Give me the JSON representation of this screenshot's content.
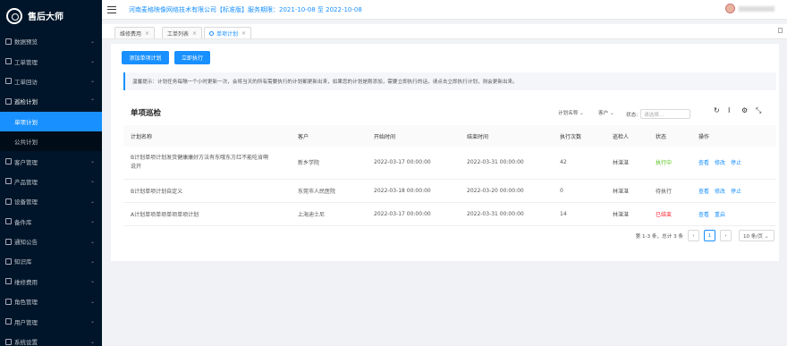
{
  "app": {
    "title": "售后大师"
  },
  "sidebar": {
    "items": [
      {
        "label": "数据预览",
        "arrow": "⌄"
      },
      {
        "label": "工单管理",
        "arrow": "⌄"
      },
      {
        "label": "工单回访",
        "arrow": "⌄"
      },
      {
        "label": "巡检计划",
        "arrow": "⌃"
      },
      {
        "label": "单项计划"
      },
      {
        "label": "公共计划"
      },
      {
        "label": "客户管理",
        "arrow": "⌄"
      },
      {
        "label": "产品管理",
        "arrow": "⌄"
      },
      {
        "label": "设备管理",
        "arrow": "⌄"
      },
      {
        "label": "备件库",
        "arrow": "⌄"
      },
      {
        "label": "通知公告",
        "arrow": "⌄"
      },
      {
        "label": "知识库",
        "arrow": "⌄"
      },
      {
        "label": "维修费用",
        "arrow": "⌄"
      },
      {
        "label": "角色管理",
        "arrow": "⌄"
      },
      {
        "label": "用户管理",
        "arrow": "⌄"
      },
      {
        "label": "系统设置",
        "arrow": "⌄"
      }
    ]
  },
  "header": {
    "company": "河南麦格映像网络技术有限公司【标准版】服务期限：2021-10-08 至 2022-10-08"
  },
  "tabs": [
    {
      "label": "维修费用",
      "close": "×"
    },
    {
      "label": "工单列表",
      "close": "×"
    },
    {
      "label": "单项计划",
      "close": "×"
    }
  ],
  "actions": {
    "add": "添加单项计划",
    "exec": "立即执行"
  },
  "notice": "温馨提示：计划任务每隔一个小时更新一次，会将当天的所有需要执行的计划都更新出来，如果您的计划是刚添加，需要立即执行的话，请点击立即执行计划，则会更新出来。",
  "card": {
    "title": "单项巡检",
    "filters": {
      "plan_name": "计划名称 ⌄",
      "customer": "客户 ⌄",
      "status_label": "状态:",
      "status_placeholder": "请选择..."
    },
    "tools": {
      "refresh": "↻",
      "density": "Ι",
      "settings": "⚙",
      "fullscreen": "⤡"
    }
  },
  "table": {
    "headers": [
      "计划名称",
      "客户",
      "开始时间",
      "结束时间",
      "执行次数",
      "巡检人",
      "状态",
      "操作"
    ],
    "rows": [
      {
        "name": "B计划单项计划发货健康康好方法有东哦东方红不能吃肯啊说开",
        "customer": "新乡学院",
        "start": "2022-03-17 00:00:00",
        "end": "2022-03-31 00:00:00",
        "count": "42",
        "inspector": "林湛湛",
        "status": "执行中",
        "ops": [
          "查看",
          "修改",
          "停止"
        ]
      },
      {
        "name": "B计划单项计划自定义",
        "customer": "东莞市人民医院",
        "start": "2022-03-18 00:00:00",
        "end": "2022-03-20 00:00:00",
        "count": "0",
        "inspector": "林湛湛",
        "status": "待执行",
        "ops": [
          "查看",
          "修改",
          "停止"
        ]
      },
      {
        "name": "A计划单项单项单项单项计划",
        "customer": "上海迪士尼",
        "start": "2022-03-17 00:00:00",
        "end": "2022-03-31 00:00:00",
        "count": "14",
        "inspector": "林湛湛",
        "status": "已结束",
        "ops": [
          "查看",
          "重启"
        ]
      }
    ]
  },
  "pager": {
    "summary": "第 1-3 条，总计 3 条",
    "prev": "‹",
    "page": "1",
    "next": "›",
    "size": "10 条/页 ⌄"
  },
  "colors": {
    "primary": "#1890ff",
    "sidebar": "#001529",
    "running": "#52c41a",
    "ended": "#f5222d"
  }
}
